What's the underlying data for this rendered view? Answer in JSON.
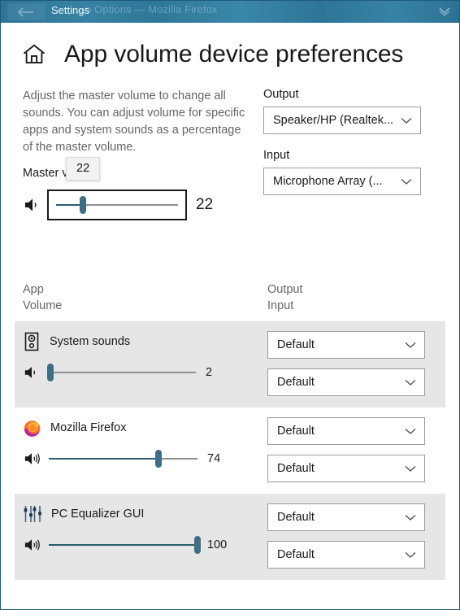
{
  "titlebar": {
    "back_icon": "back-arrow-icon",
    "title": "Settings",
    "ghost_text": "...o Options — Mozilla Firefox",
    "chevron_icon": "chevron-down-icon"
  },
  "header": {
    "home_icon": "home-icon",
    "title": "App volume  device preferences"
  },
  "top": {
    "description": "Adjust the master volume to change all sounds. You can adjust volume for specific apps and system sounds as a percentage of the master volume.",
    "master_label": "Master volume",
    "master_tooltip": "22",
    "master_value": "22",
    "master_percent": 22,
    "master_speaker_icon": "speaker-low-icon",
    "output_label": "Output",
    "output_value": "Speaker/HP (Realtek...",
    "input_label": "Input",
    "input_value": "Microphone Array (...",
    "dropdown_icon": "chevron-down-icon"
  },
  "columns": {
    "left_line1": "App",
    "left_line2": "Volume",
    "right_line1": "Output",
    "right_line2": "Input"
  },
  "apps": [
    {
      "name": "System sounds",
      "icon": "system-sounds-icon",
      "volume": "2",
      "percent": 2,
      "speaker_icon": "speaker-low-icon",
      "output": "Default",
      "input": "Default",
      "shaded": true
    },
    {
      "name": "Mozilla Firefox",
      "icon": "firefox-icon",
      "volume": "74",
      "percent": 74,
      "speaker_icon": "speaker-high-icon",
      "output": "Default",
      "input": "Default",
      "shaded": false
    },
    {
      "name": "PC Equalizer GUI",
      "icon": "equalizer-icon",
      "volume": "100",
      "percent": 100,
      "speaker_icon": "speaker-high-icon",
      "output": "Default",
      "input": "Default",
      "shaded": true
    }
  ],
  "colors": {
    "titlebar": "#317a9c",
    "accent_slider": "#3d6e85",
    "row_shade": "#e6e6e6",
    "muted_text": "#666666"
  }
}
